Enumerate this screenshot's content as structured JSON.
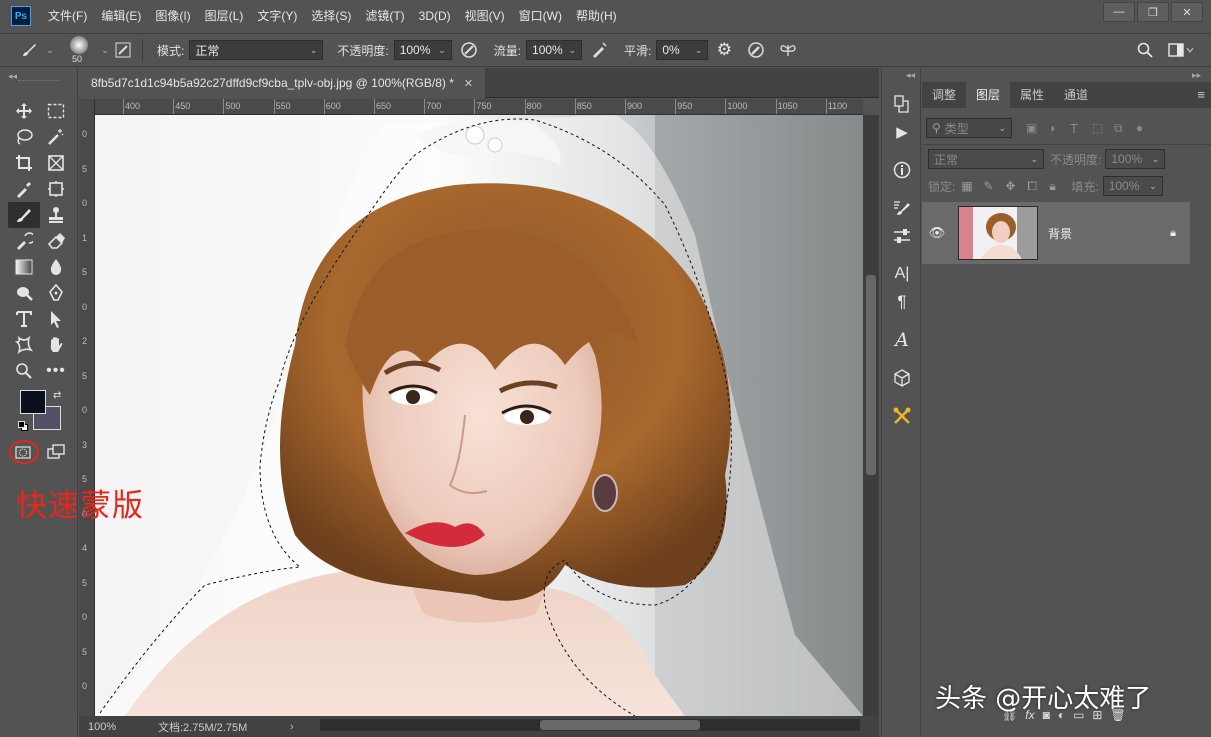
{
  "app": {
    "logo": "Ps"
  },
  "menu": [
    "文件(F)",
    "编辑(E)",
    "图像(I)",
    "图层(L)",
    "文字(Y)",
    "选择(S)",
    "滤镜(T)",
    "3D(D)",
    "视图(V)",
    "窗口(W)",
    "帮助(H)"
  ],
  "window_controls": {
    "minimize": "—",
    "restore": "❐",
    "close": "✕"
  },
  "options": {
    "brush_size": "50",
    "mode_label": "模式:",
    "mode_value": "正常",
    "opacity_label": "不透明度:",
    "opacity_value": "100%",
    "flow_label": "流量:",
    "flow_value": "100%",
    "smooth_label": "平滑:",
    "smooth_value": "0%"
  },
  "document": {
    "tab_title": "8fb5d7c1d1c94b5a92c27dffd9cf9cba_tplv-obj.jpg @ 100%(RGB/8) *",
    "close": "✕",
    "ruler_h": [
      "400",
      "450",
      "500",
      "550",
      "600",
      "650",
      "700",
      "750",
      "800",
      "850",
      "900",
      "950",
      "1000",
      "1050",
      "1100"
    ],
    "ruler_v": [
      "0",
      "5",
      "0",
      "1",
      "5",
      "0",
      "2",
      "5",
      "0",
      "3",
      "5",
      "0",
      "4",
      "5",
      "0",
      "5",
      "0"
    ],
    "zoom": "100%",
    "doc_info": "文档:2.75M/2.75M"
  },
  "panel": {
    "tabs": [
      "调整",
      "图层",
      "属性",
      "通道"
    ],
    "active_tab": "图层",
    "filter_label": "类型",
    "blend_mode": "正常",
    "opacity_label": "不透明度:",
    "opacity_value": "100%",
    "lock_label": "锁定:",
    "fill_label": "填充:",
    "fill_value": "100%",
    "layer_name": "背景"
  },
  "annotation": {
    "text": "快速蒙版",
    "color": "#e8261a"
  },
  "watermark": "头条 @开心太难了",
  "colors": {
    "foreground": "#0b0f1e",
    "background": "#555064",
    "accent_annotation": "#e8261a"
  }
}
